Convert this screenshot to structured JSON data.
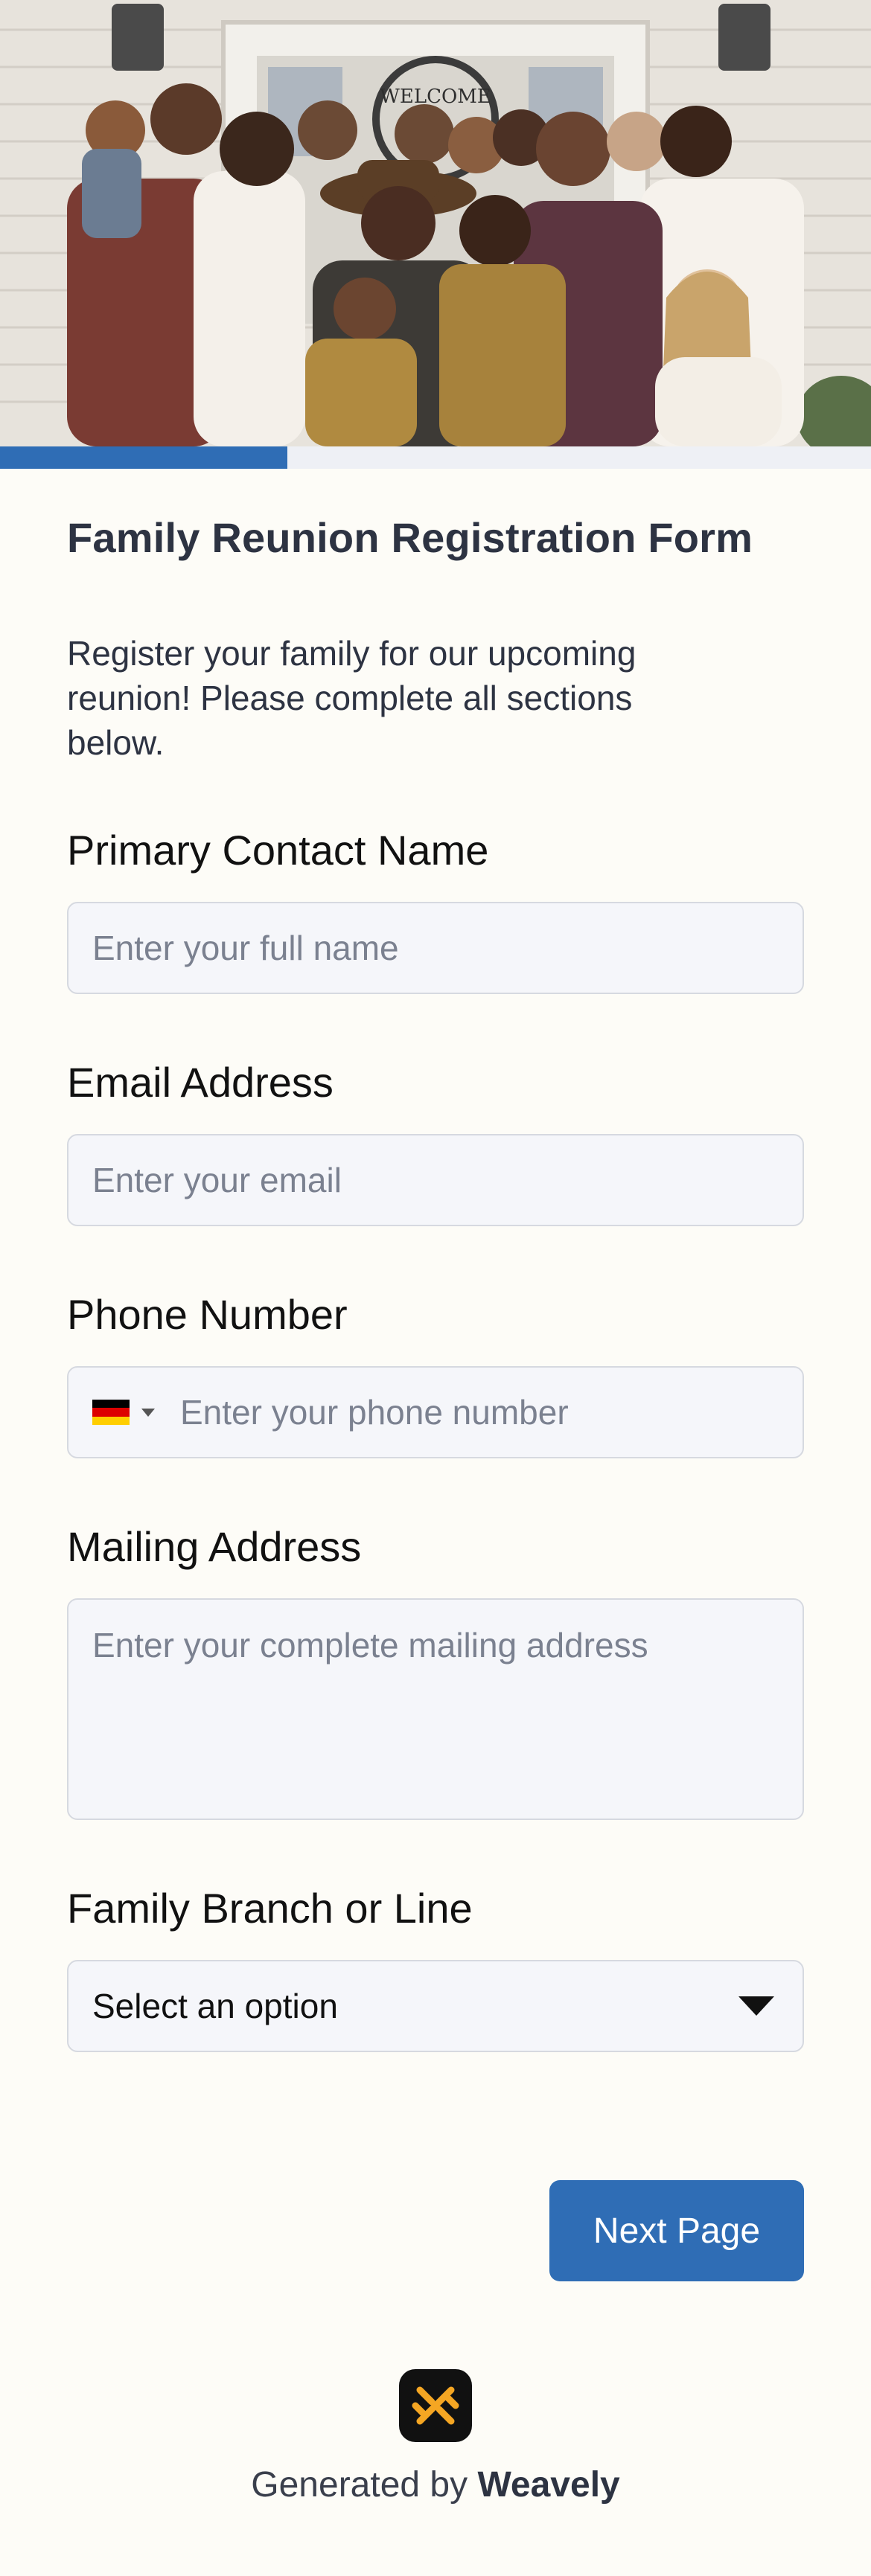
{
  "hero": {
    "image_label": "",
    "sign_text": "WELCOME"
  },
  "progress": {
    "value": 0.33
  },
  "form": {
    "title": "Family Reunion Registration Form",
    "description": "Register your family for our upcoming reunion! Please complete all sections below.",
    "fields": {
      "name": {
        "label": "Primary Contact Name",
        "placeholder": "Enter your full name"
      },
      "email": {
        "label": "Email Address",
        "placeholder": "Enter your email"
      },
      "phone": {
        "label": "Phone Number",
        "placeholder": "Enter your phone number",
        "country_flag": "de-flag-icon"
      },
      "address": {
        "label": "Mailing Address",
        "placeholder": "Enter your complete mailing address"
      },
      "branch": {
        "label": "Family Branch or Line",
        "selected": "Select an option"
      }
    },
    "next_label": "Next Page"
  },
  "footer": {
    "prefix": "Generated by ",
    "brand": "Weavely",
    "logo_icon": "weavely-logo-icon"
  },
  "colors": {
    "accent": "#2f6db5",
    "background": "#fdfcf7",
    "field_bg": "#f5f6fa",
    "logo_mark": "#f5a623"
  }
}
